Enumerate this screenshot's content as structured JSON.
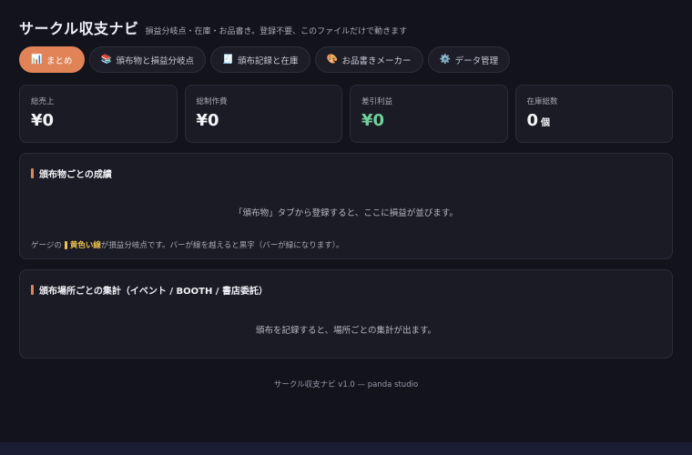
{
  "header": {
    "title": "サークル収支ナビ",
    "subtitle": "損益分岐点・在庫・お品書き。登録不要、このファイルだけで動きます"
  },
  "tabs": [
    {
      "icon": "📊",
      "label": "まとめ",
      "active": true
    },
    {
      "icon": "📚",
      "label": "頒布物と損益分岐点"
    },
    {
      "icon": "🧾",
      "label": "頒布記録と在庫"
    },
    {
      "icon": "🎨",
      "label": "お品書きメーカー"
    },
    {
      "icon": "⚙️",
      "label": "データ管理"
    }
  ],
  "stats": {
    "sales": {
      "label": "総売上",
      "value": "¥0"
    },
    "cost": {
      "label": "総制作費",
      "value": "¥0"
    },
    "profit": {
      "label": "差引利益",
      "value": "¥0",
      "color": "#6fd09a"
    },
    "stock": {
      "label": "在庫総数",
      "value": "0",
      "unit": "個"
    }
  },
  "panel_items": {
    "title": "頒布物ごとの成績",
    "empty": "「頒布物」タブから登録すると、ここに損益が並びます。",
    "note_before": "ゲージの",
    "note_highlight": "黄色い線",
    "note_after": "が損益分岐点です。バーが線を越えると黒字（バーが緑になります）。"
  },
  "panel_places": {
    "title": "頒布場所ごとの集計（イベント / BOOTH / 書店委託）",
    "empty": "頒布を記録すると、場所ごとの集計が出ます。"
  },
  "footer": "サークル収支ナビ v1.0 — panda studio",
  "colors": {
    "accent": "#e08458",
    "background": "#13131c",
    "card": "#1b1b25",
    "highlight": "#f1c34d"
  }
}
